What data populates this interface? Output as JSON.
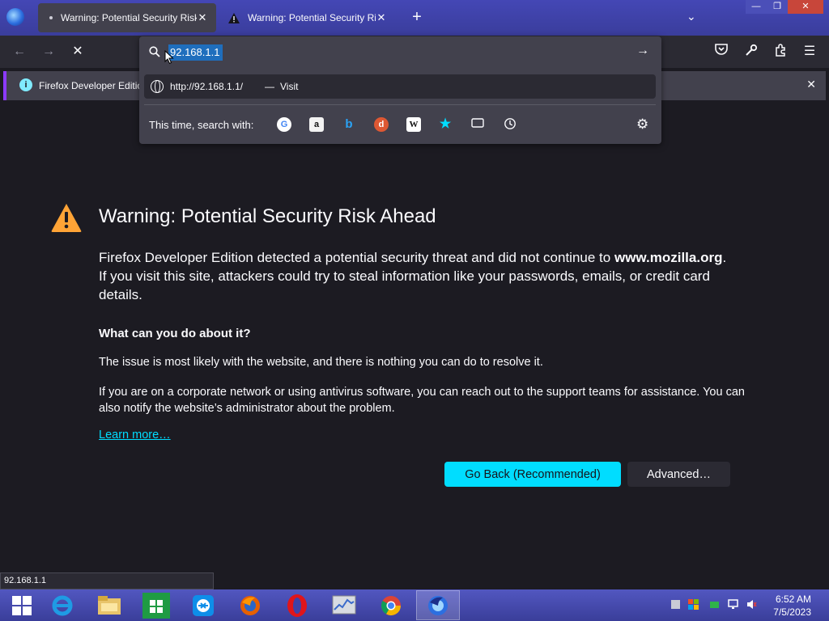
{
  "tabs": [
    {
      "label": "Warning: Potential Security Risk Ahead",
      "active": true
    },
    {
      "label": "Warning: Potential Security Risk Ahead",
      "active": false
    }
  ],
  "notification": {
    "text": "Firefox Developer Edition"
  },
  "urlbar": {
    "value": "92.168.1.1",
    "suggestion_url": "http://92.168.1.1/",
    "suggestion_separator": "—",
    "suggestion_action": "Visit",
    "search_with_label": "This time, search with:"
  },
  "search_engines": [
    "google-icon",
    "amazon-icon",
    "bing-icon",
    "duckduckgo-icon",
    "wikipedia-icon",
    "bookmarks-icon",
    "tabs-icon",
    "history-icon"
  ],
  "error_page": {
    "title": "Warning: Potential Security Risk Ahead",
    "intro_pre": "Firefox Developer Edition detected a potential security threat and did not continue to",
    "intro_host": "www.mozilla.org",
    "intro_post": ". If you visit this site, attackers could try to steal information like your passwords, emails, or credit card details.",
    "question": "What can you do about it?",
    "para1": "The issue is most likely with the website, and there is nothing you can do to resolve it.",
    "para2": "If you are on a corporate network or using antivirus software, you can reach out to the support teams for assistance. You can also notify the website’s administrator about the problem.",
    "learn_more": "Learn more…",
    "go_back": "Go Back (Recommended)",
    "advanced": "Advanced…"
  },
  "status_text": "92.168.1.1",
  "taskbar": {
    "time": "6:52 AM",
    "date": "7/5/2023"
  },
  "colors": {
    "accent": "#00ddff",
    "warning": "#ffa436",
    "page_bg": "#1c1b22"
  }
}
